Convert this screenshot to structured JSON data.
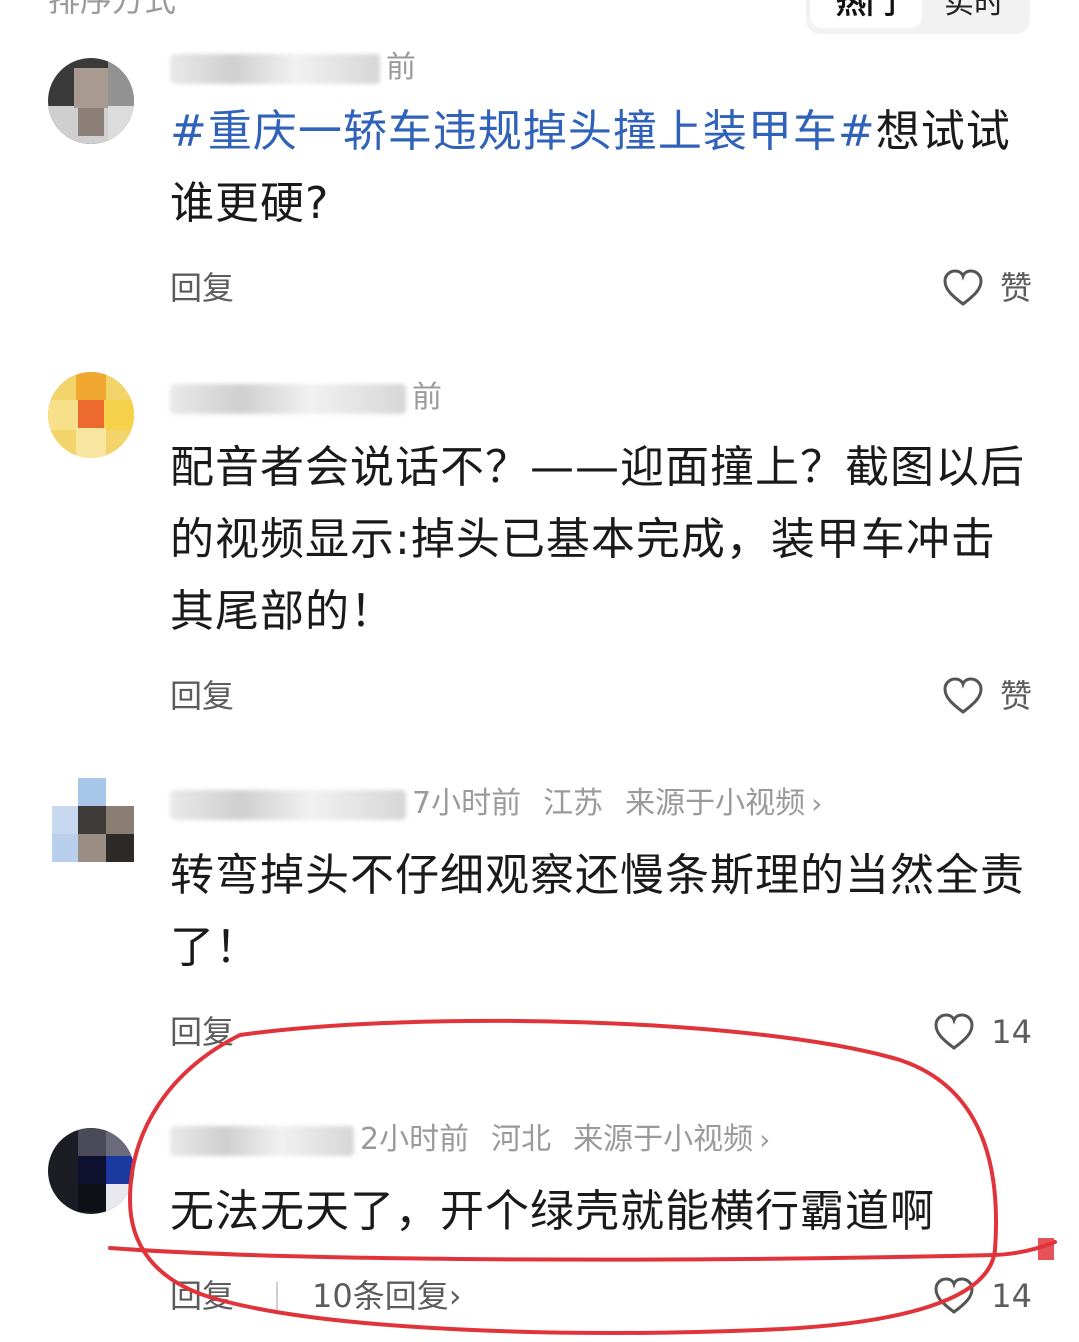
{
  "sort": {
    "label": "排序方式",
    "options": [
      "热门",
      "实时"
    ],
    "selected": "热门"
  },
  "comments": [
    {
      "meta": "前",
      "hashtag": "#重庆一轿车违规掉头撞上装甲车#",
      "text": "想试试谁更硬?",
      "reply_label": "回复",
      "like_label": "赞"
    },
    {
      "meta": "前",
      "text": "配音者会说话不？——迎面撞上？截图以后的视频显示:掉头已基本完成，装甲车冲击其尾部的！",
      "reply_label": "回复",
      "like_label": "赞"
    },
    {
      "time": "7小时前",
      "location": "江苏",
      "source": "来源于小视频",
      "text": "转弯掉头不仔细观察还慢条斯理的当然全责了！",
      "reply_label": "回复",
      "like_label": "14"
    },
    {
      "time": "2小时前",
      "location": "河北",
      "source": "来源于小视频",
      "text": "无法无天了，开个绿壳就能横行霸道啊",
      "reply_label": "回复",
      "replies_link": "10条回复",
      "like_label": "14"
    }
  ],
  "icons": {
    "like": "heart-outline-icon",
    "chevron": "chevron-right-icon"
  },
  "colors": {
    "hashtag": "#2f62b8",
    "annotation": "#e0343a",
    "meta": "#9a9a9a"
  }
}
